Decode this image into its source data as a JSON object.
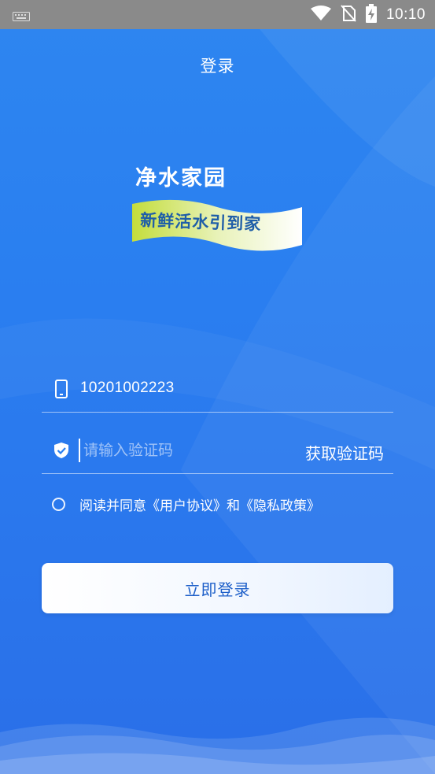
{
  "status_bar": {
    "time": "10:10",
    "icons": [
      "keyboard-icon",
      "wifi-icon",
      "no-sim-icon",
      "battery-charging-icon"
    ]
  },
  "header": {
    "title": "登录"
  },
  "logo": {
    "line1": "净水家园",
    "line2": "新鲜活水引到家"
  },
  "phone_field": {
    "value": "10201002223",
    "icon": "phone-icon"
  },
  "code_field": {
    "placeholder": "请输入验证码",
    "icon": "shield-check-icon",
    "get_code_label": "获取验证码"
  },
  "agreement": {
    "text": "阅读并同意《用户协议》和《隐私政策》",
    "checked": false
  },
  "login_button": {
    "label": "立即登录"
  },
  "colors": {
    "background": "#2a7ff0",
    "button_text": "#1d5fc9",
    "status_bar": "#8a8a8a"
  }
}
